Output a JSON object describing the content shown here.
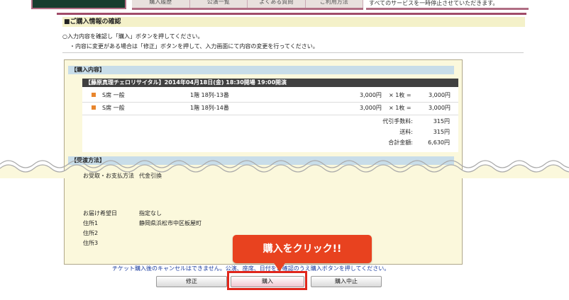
{
  "topnav": {
    "items": [
      "購入履歴",
      "公演一覧",
      "よくある質問",
      "ご利用方法"
    ],
    "notice": "すべてのサービスを一時停止させていただきます。"
  },
  "section_title": "■ご購入情報の確認",
  "instructions": [
    "○入力内容を確認し「購入」ボタンを押してください。",
    "・内容に変更がある場合は「修正」ボタンを押して、入力画面にて内容の変更を行ってください。"
  ],
  "purchase_section": {
    "label": "【購入内容】",
    "performance": "【藤原真理チェロリサイタル】2014年04月18日(金) 18:30開場 19:00開演",
    "tickets": [
      {
        "seat_type": "S席 一般",
        "seat": "1階 18列-13番",
        "price": "3,000円",
        "qty": "× 1枚 =",
        "subtotal": "3,000円"
      },
      {
        "seat_type": "S席 一般",
        "seat": "1階 18列-14番",
        "price": "3,000円",
        "qty": "× 1枚 =",
        "subtotal": "3,000円"
      }
    ],
    "summary": [
      {
        "label": "代引手数料:",
        "value": "315円"
      },
      {
        "label": "送料:",
        "value": "315円"
      },
      {
        "label": "合計金額:",
        "value": "6,630円"
      }
    ]
  },
  "delivery_section": {
    "label": "【受渡方法】",
    "payment_label": "お受取・お支払方法",
    "payment_value": "代金引換",
    "date_label": "お届け希望日",
    "date_value": "指定なし",
    "address1_label": "住所1",
    "address1_value": "静岡県浜松市中区板屋町",
    "address2_label": "住所2",
    "address3_label": "住所3"
  },
  "callout": "購入をクリック!!",
  "cancel_note": "チケット購入後のキャンセルはできません。公演、座席、日付をご確認のうえ購入ボタンを押してください。",
  "buttons": {
    "modify": "修正",
    "buy": "購入",
    "cancel": "購入中止"
  },
  "colors": {
    "frame": "#a04b68",
    "callout": "#e8421f",
    "highlight_box": "#e0261c",
    "band": "#c8dde9",
    "panel": "#fbf8dc",
    "bullet": "#e8862d"
  }
}
